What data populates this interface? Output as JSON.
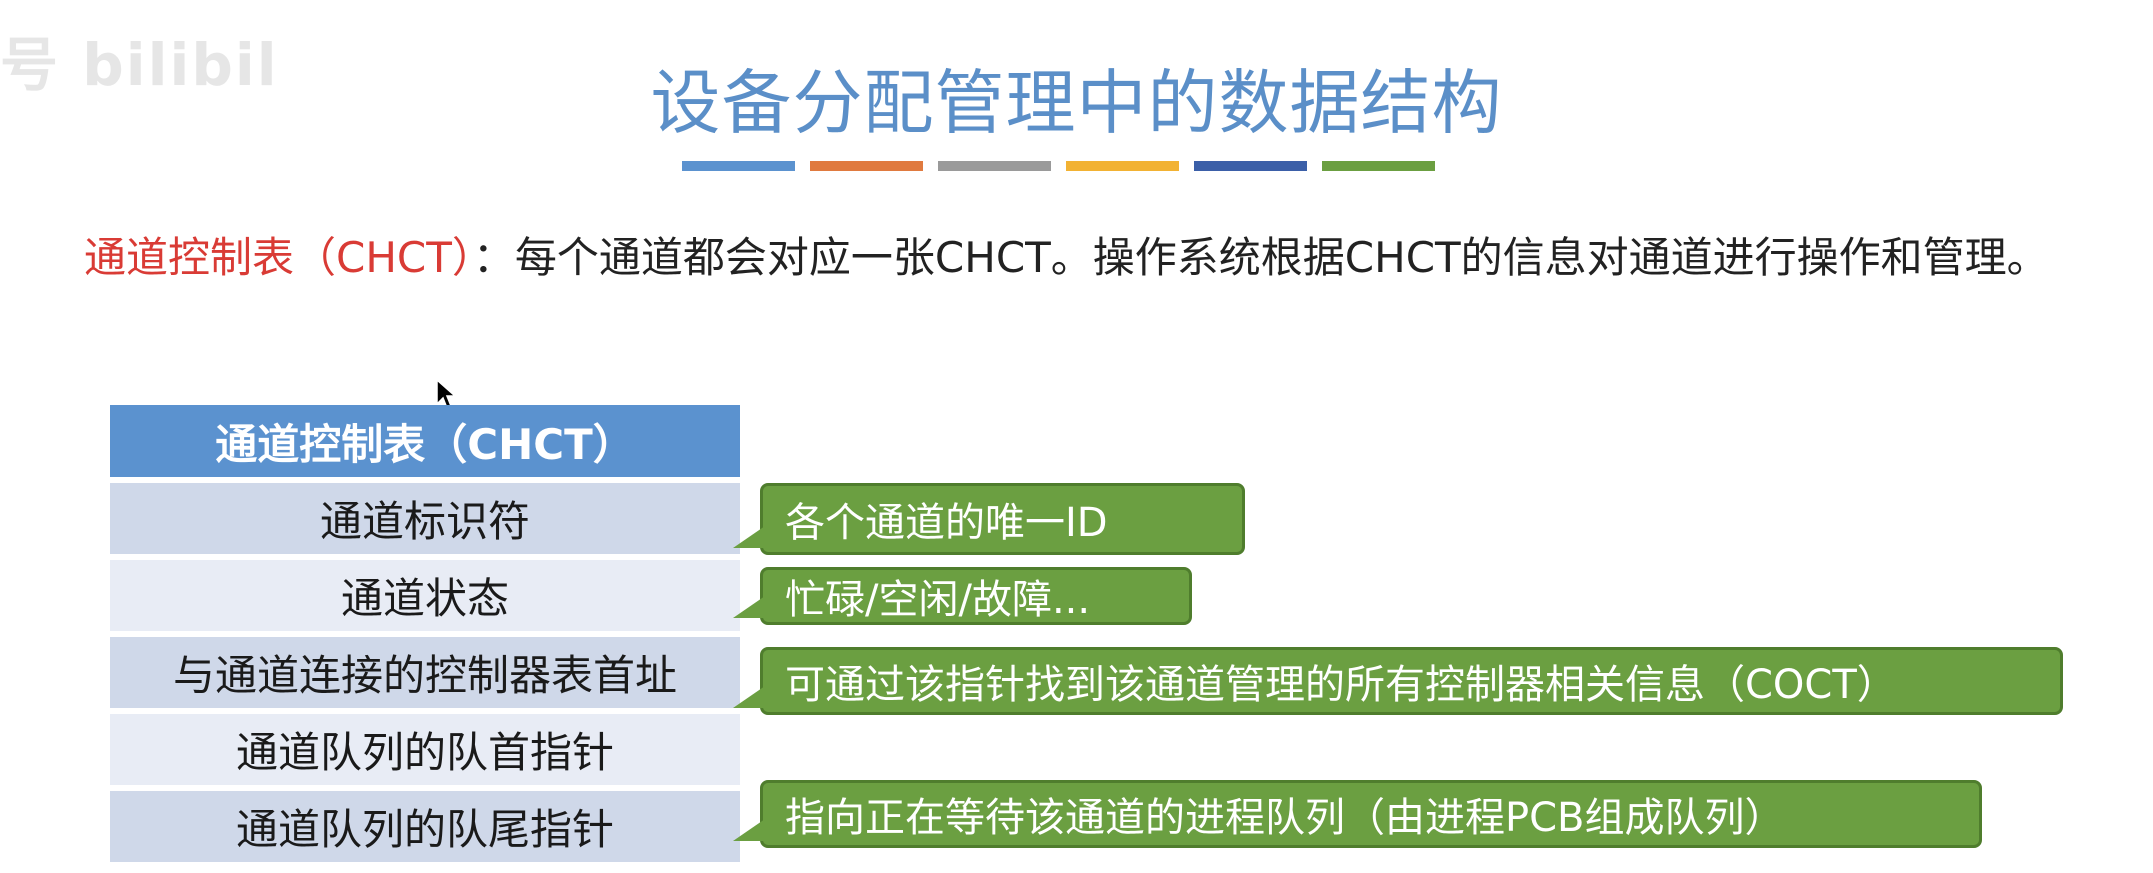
{
  "watermark": "号 bilibili",
  "slide": {
    "title": "设备分配管理中的数据结构",
    "title_bar_colors": [
      "#5b92cf",
      "#e07a3f",
      "#9a9a9a",
      "#f2b233",
      "#3b5fa8",
      "#6b9f41"
    ],
    "intro_term": "通道控制表（CHCT）",
    "intro_sep": "：",
    "intro_text": "每个通道都会对应一张CHCT。操作系统根据CHCT的信息对通道进行操作和管理。"
  },
  "table": {
    "header": "通道控制表（CHCT）",
    "rows": [
      "通道标识符",
      "通道状态",
      "与通道连接的控制器表首址",
      "通道队列的队首指针",
      "通道队列的队尾指针"
    ]
  },
  "callouts": [
    "各个通道的唯一ID",
    "忙碌/空闲/故障...",
    "可通过该指针找到该通道管理的所有控制器相关信息（COCT）",
    "指向正在等待该通道的进程队列（由进程PCB组成队列）"
  ]
}
